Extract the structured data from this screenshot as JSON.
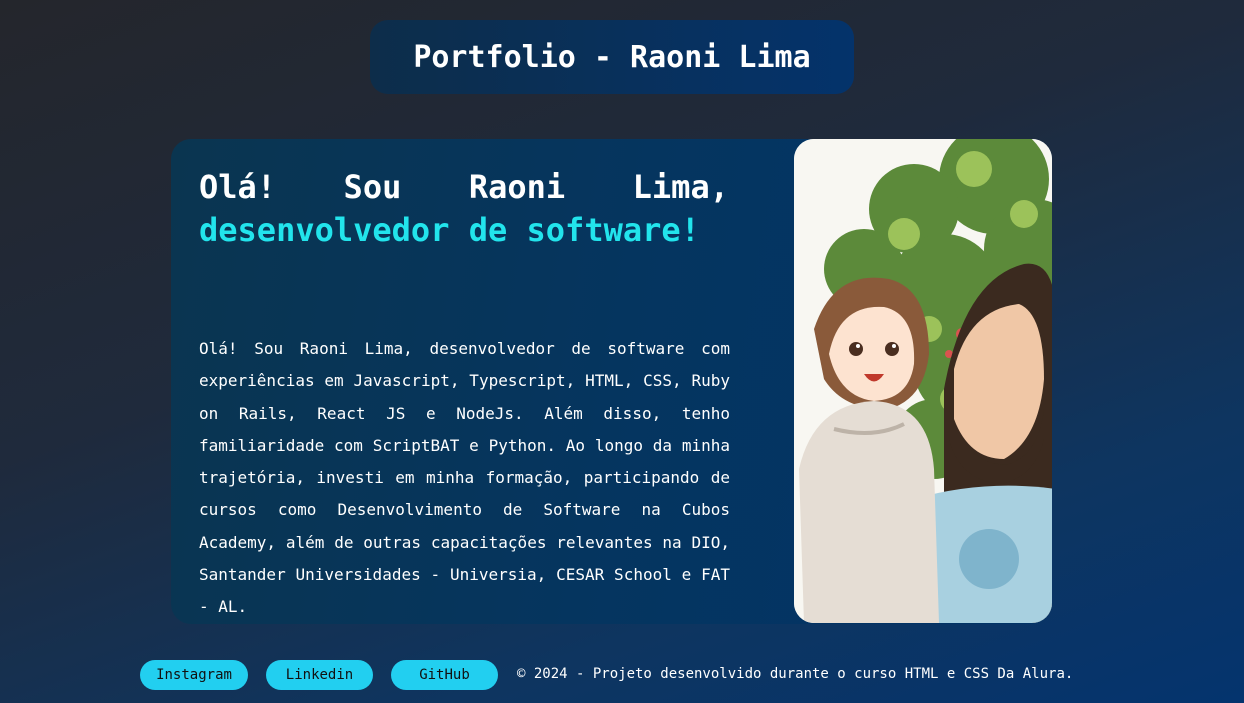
{
  "header": {
    "title": "Portfolio - Raoni Lima"
  },
  "hero": {
    "line1_words": [
      "Olá!",
      "Sou",
      "Raoni",
      "Lima,"
    ],
    "line2": "desenvolvedor de software!",
    "bio": "Olá! Sou Raoni Lima, desenvolvedor de software com experiências em Javascript, Typescript, HTML, CSS, Ruby on Rails, React JS e NodeJs. Além disso, tenho familiaridade com ScriptBAT e Python. Ao longo da minha trajetória, investi em minha formação, participando de cursos como Desenvolvimento de Software na Cubos Academy, além de outras capacitações relevantes na DIO, Santander Universidades - Universia, CESAR School e FAT - AL."
  },
  "footer": {
    "links": [
      "Instagram",
      "Linkedin",
      "GitHub"
    ],
    "copyright": "© 2024 - Projeto desenvolvido durante o curso HTML e CSS Da Alura."
  },
  "colors": {
    "accent": "#22e4ec",
    "button": "#22cff0"
  }
}
